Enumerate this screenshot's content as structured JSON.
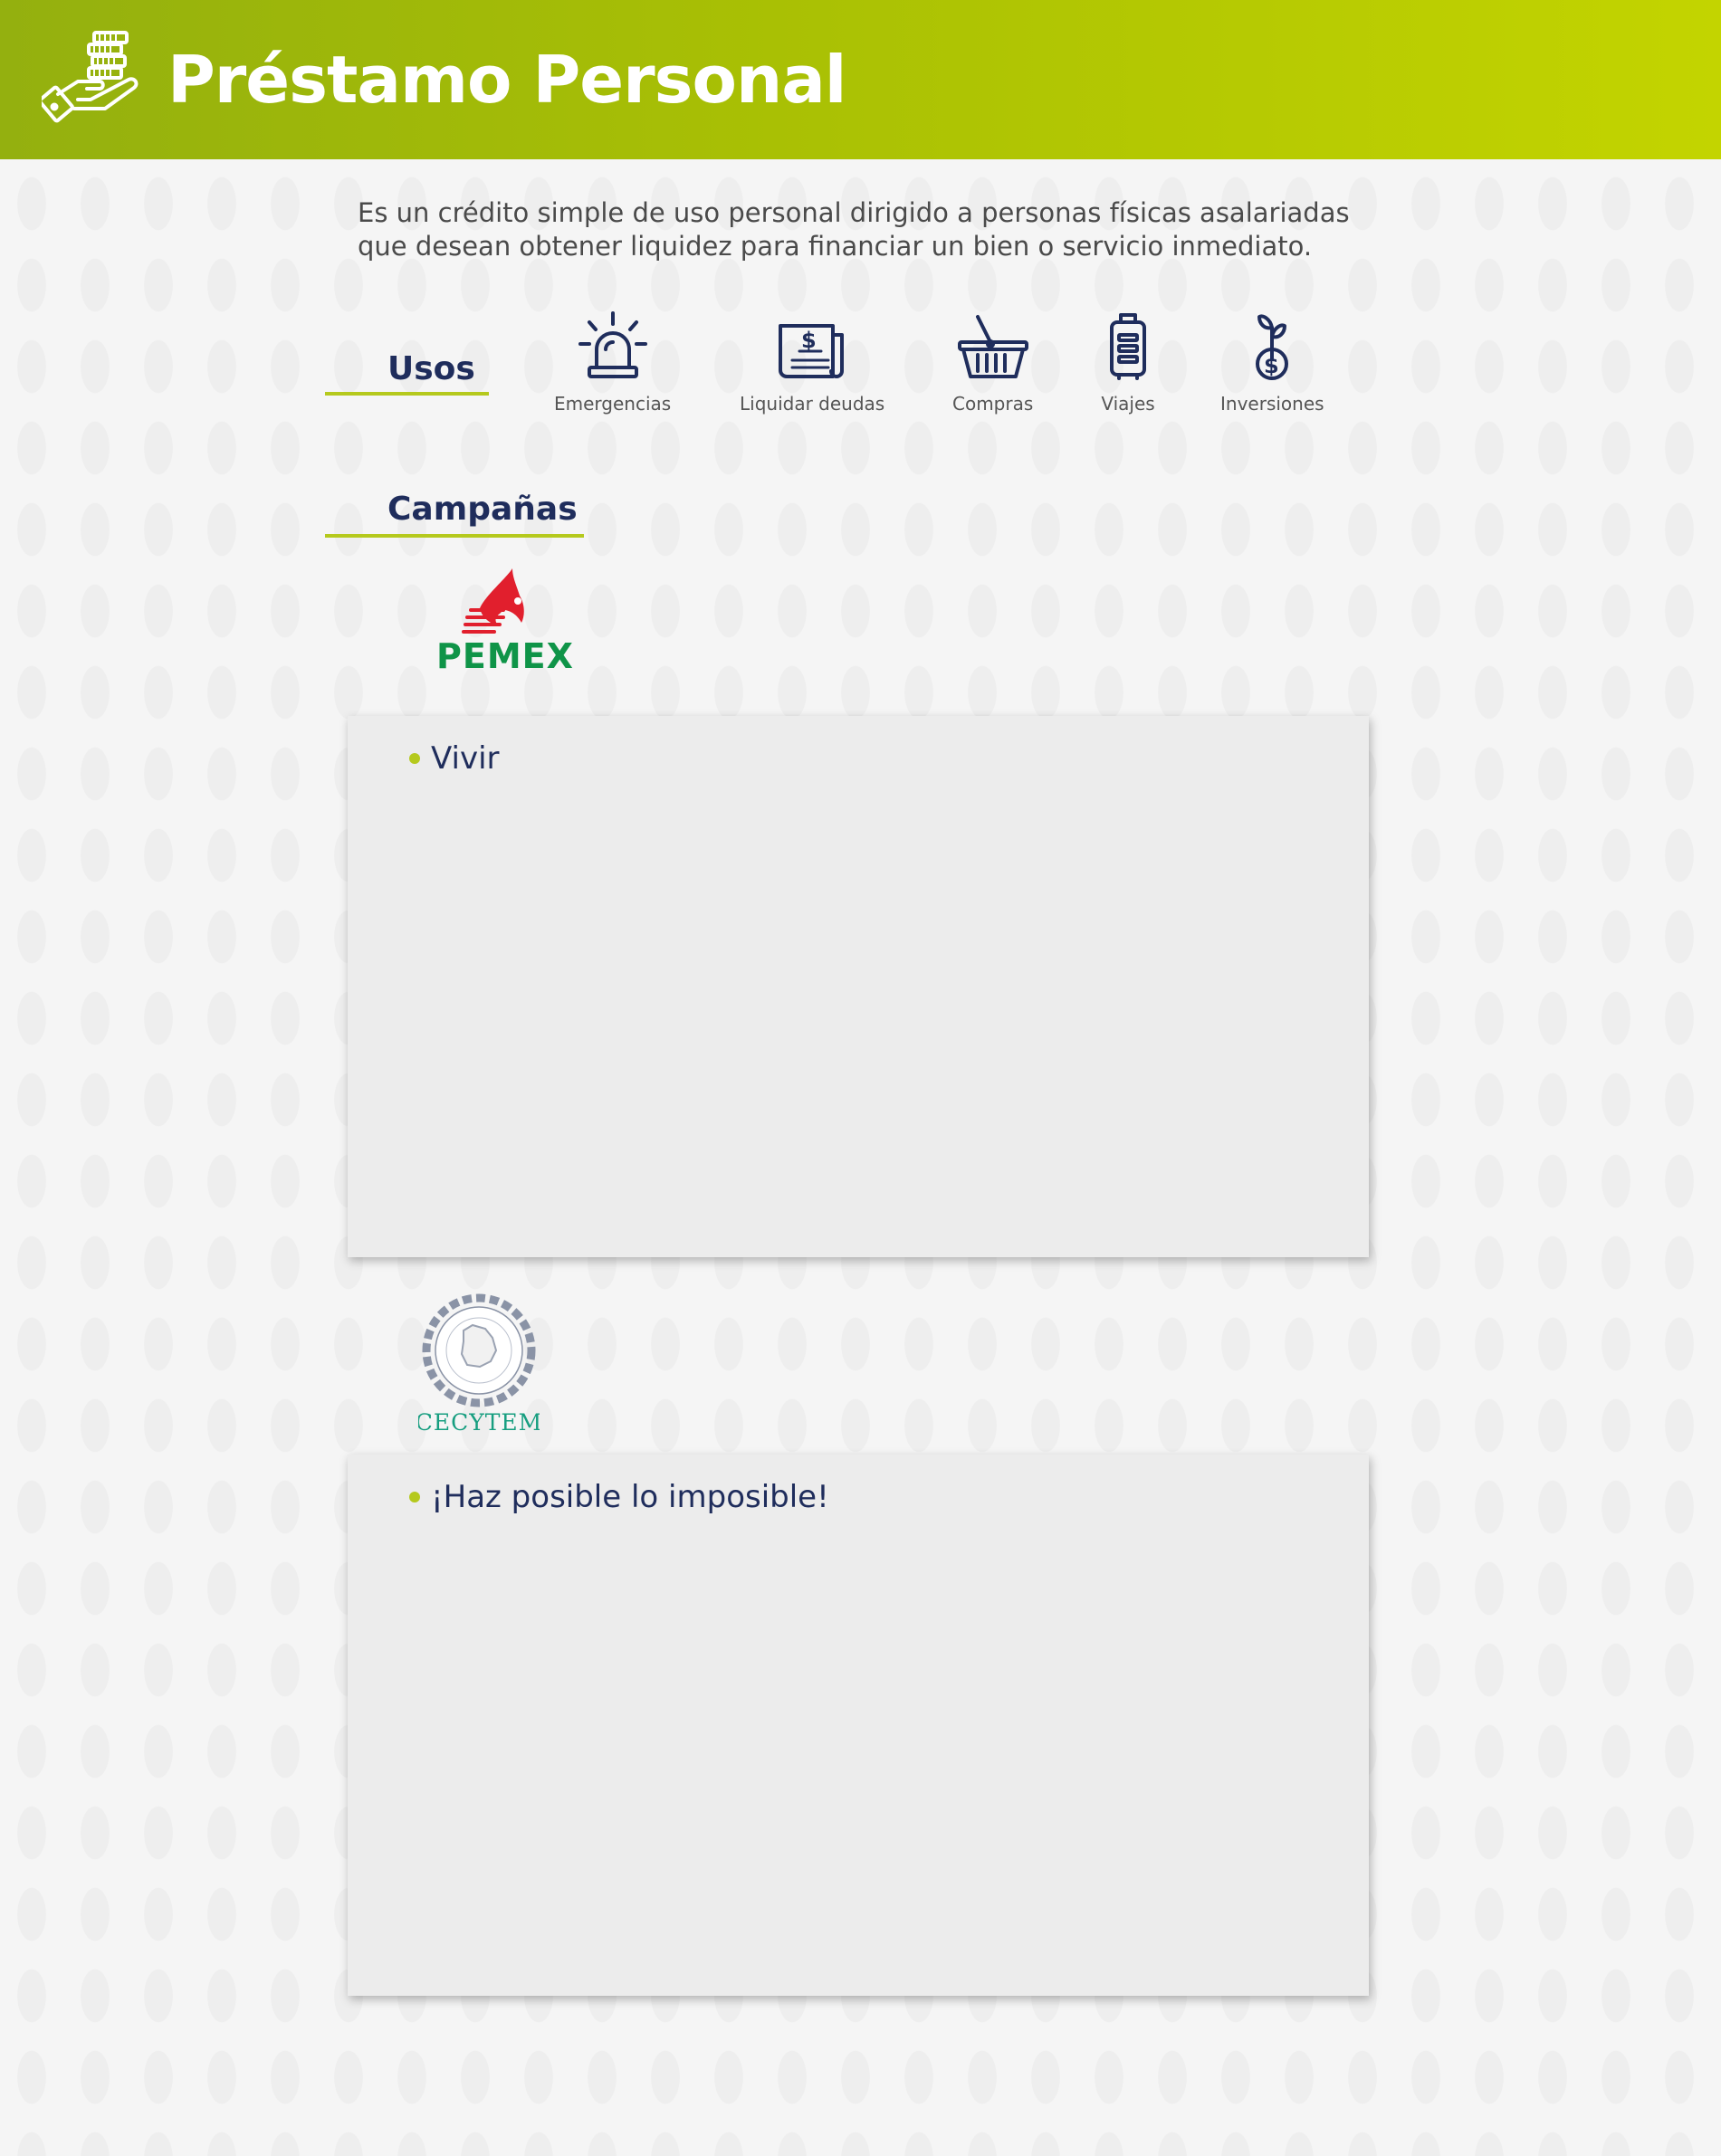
{
  "header": {
    "title": "Préstamo Personal",
    "icon": "hand-coins-icon",
    "bg_from": "#94b00f",
    "bg_to": "#c3d400"
  },
  "intro": {
    "text": "Es un crédito simple de uso personal dirigido a personas físicas asalariadas que desean obtener liquidez para financiar un bien o servicio inmediato."
  },
  "usos": {
    "heading": "Usos",
    "items": [
      {
        "label": "Emergencias",
        "icon": "siren-icon"
      },
      {
        "label": "Liquidar deudas",
        "icon": "invoice-icon"
      },
      {
        "label": "Compras",
        "icon": "basket-icon"
      },
      {
        "label": "Viajes",
        "icon": "suitcase-icon"
      },
      {
        "label": "Inversiones",
        "icon": "money-plant-icon"
      }
    ]
  },
  "campanas": {
    "heading": "Campañas",
    "items": [
      {
        "logo_text": "PEMEX",
        "logo": "pemex-logo",
        "tagline": "Vivir"
      },
      {
        "logo_text": "CECYTEM",
        "logo": "cecytem-logo",
        "tagline": "¡Haz posible lo imposible!"
      }
    ]
  },
  "colors": {
    "accent": "#b5c91d",
    "navy": "#1f2d5c",
    "card_bg": "#ececec",
    "pemex_green": "#0f9448",
    "pemex_red": "#e11f2d",
    "cecytem_teal": "#179e80"
  }
}
